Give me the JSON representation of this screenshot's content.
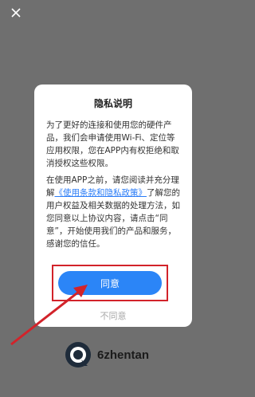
{
  "dialog": {
    "title": "隐私说明",
    "para1": "为了更好的连接和使用您的硬件产品，我们会申请使用Wi-Fi、定位等应用权限，您在APP内有权拒绝和取消授权这些权限。",
    "para2_before": "在使用APP之前，请您阅读并充分理解",
    "para2_link": "《使用条款和隐私政策》",
    "para2_after": "了解您的用户权益及相关数据的处理方法，如您同意以上协议内容，请点击“同意”，开始使用我们的产品和服务，感谢您的信任。",
    "agree_label": "同意",
    "disagree_label": "不同意"
  },
  "brand": {
    "name": "6zhentan"
  },
  "icons": {
    "close": "close-icon",
    "logo": "brand-logo-icon"
  },
  "colors": {
    "accent": "#2b85f7",
    "highlight": "#d2232a",
    "overlay": "#6f6f6f"
  }
}
